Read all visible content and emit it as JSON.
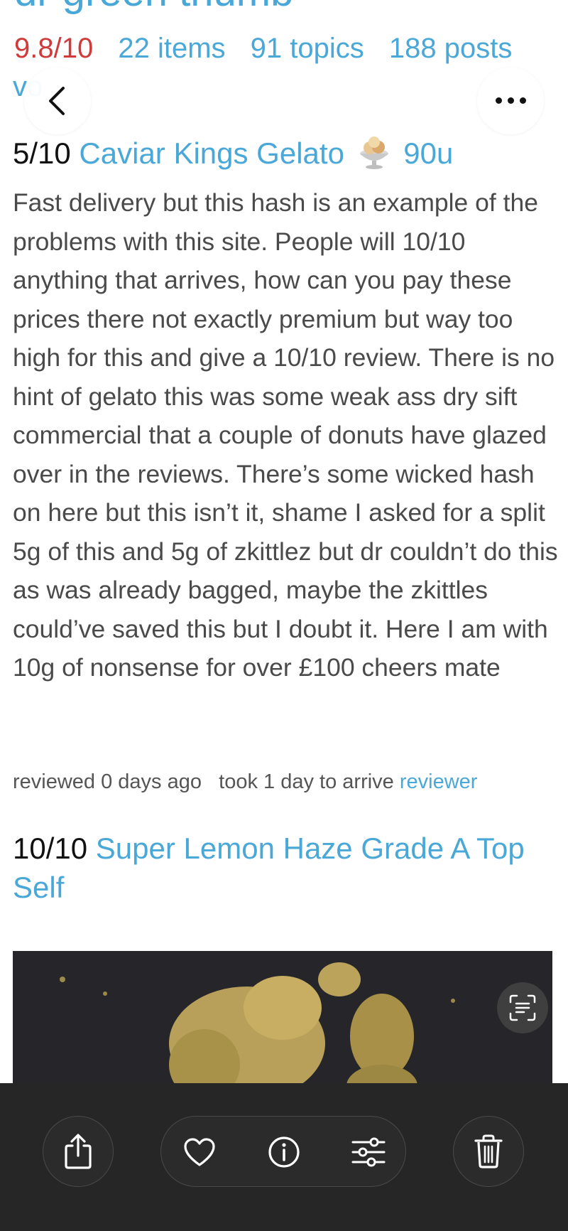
{
  "header": {
    "vendor_name": "dr green thumb",
    "rating": "9.8/10",
    "items": "22 items",
    "topics": "91 topics",
    "posts": "188 posts",
    "partial_link": "vo"
  },
  "browser": {
    "back_icon": "chevron-left-icon",
    "more_icon": "ellipsis-icon"
  },
  "review1": {
    "score": "5/10",
    "product": "Caviar Kings Gelato",
    "emoji_icon": "ice-cream-icon",
    "amount": "90u",
    "body": "Fast delivery but this hash is an example of the problems with this site. People will 10/10 anything that arrives, how can you pay these prices there not exactly premium but way too high for this and give a 10/10 review. There is no hint of gelato this was some weak ass dry sift commercial that a couple of donuts have glazed over in the reviews. There’s some wicked hash on here but this isn’t it, shame I asked for a split 5g of this and 5g of zkittlez but dr couldn’t do this as was already bagged, maybe the zkittles could’ve saved this but I doubt it. Here I am with 10g of nonsense for over £100 cheers mate",
    "reviewed": "reviewed 0 days ago",
    "arrival": "took 1 day to arrive",
    "reviewer_link": "reviewer"
  },
  "review2": {
    "score": "10/10",
    "product": "Super Lemon Haze Grade A Top Self"
  },
  "photo": {
    "scan_icon": "live-text-scan-icon"
  },
  "toolbar": {
    "share_icon": "share-icon",
    "favorite_icon": "heart-icon",
    "info_icon": "info-icon",
    "adjust_icon": "sliders-icon",
    "delete_icon": "trash-icon"
  }
}
